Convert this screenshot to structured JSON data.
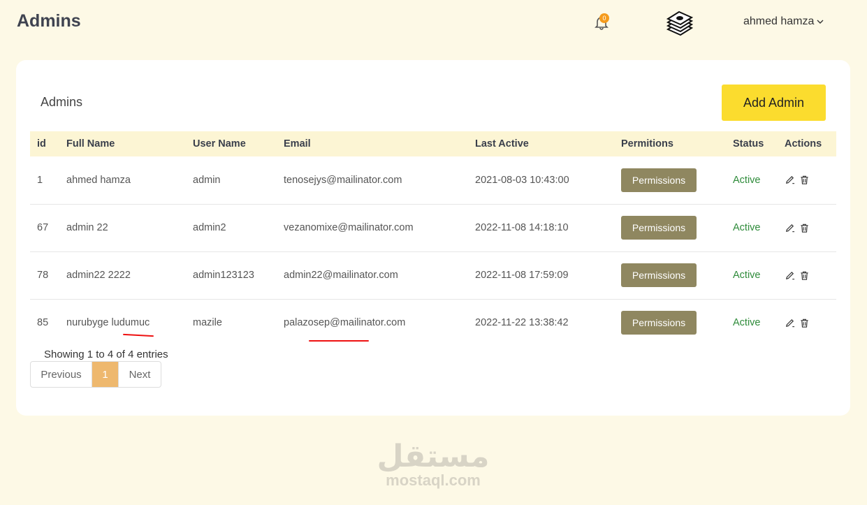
{
  "header": {
    "page_title": "Admins",
    "notification_count": "0",
    "user_name": "ahmed hamza"
  },
  "card": {
    "title": "Admins",
    "add_button": "Add Admin"
  },
  "table": {
    "columns": [
      "id",
      "Full Name",
      "User Name",
      "Email",
      "Last Active",
      "Permitions",
      "Status",
      "Actions"
    ],
    "rows": [
      {
        "id": "1",
        "full_name": "ahmed hamza",
        "user_name": "admin",
        "email": "tenosejys@mailinator.com",
        "last_active": "2021-08-03 10:43:00",
        "permissions": "Permissions",
        "status": "Active"
      },
      {
        "id": "67",
        "full_name": "admin 22",
        "user_name": "admin2",
        "email": "vezanomixe@mailinator.com",
        "last_active": "2022-11-08 14:18:10",
        "permissions": "Permissions",
        "status": "Active"
      },
      {
        "id": "78",
        "full_name": "admin22 2222",
        "user_name": "admin123123",
        "email": "admin22@mailinator.com",
        "last_active": "2022-11-08 17:59:09",
        "permissions": "Permissions",
        "status": "Active"
      },
      {
        "id": "85",
        "full_name": "nurubyge ludumuc",
        "user_name": "mazile",
        "email": "palazosep@mailinator.com",
        "last_active": "2022-11-22 13:38:42",
        "permissions": "Permissions",
        "status": "Active"
      }
    ]
  },
  "pagination": {
    "info": "Showing 1 to 4 of 4 entries",
    "previous": "Previous",
    "current": "1",
    "next": "Next"
  },
  "watermark": {
    "arabic": "مستقل",
    "latin": "mostaql.com"
  },
  "colors": {
    "background": "#fdf9e6",
    "accent": "#fbdc2e",
    "permissions_button": "#8f8760",
    "status_active": "#2e8b3a",
    "page_active": "#eeb86e"
  }
}
